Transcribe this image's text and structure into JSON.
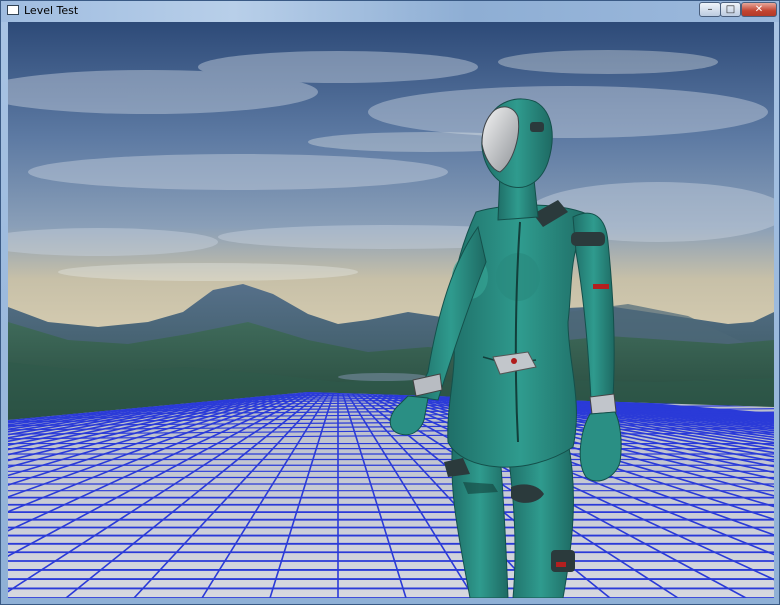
{
  "window": {
    "title": "Level Test",
    "controls": {
      "minimize": "–",
      "maximize": "□",
      "close": "✕"
    }
  },
  "scene": {
    "sky": "cloudy-sky",
    "terrain": "forested-mountains",
    "floor": "blue-grid-floor",
    "character": "teal-android-woman"
  },
  "colors": {
    "grid_line": "#2a3ad8",
    "floor": "#c9ccd6",
    "character_body": "#2a8f84",
    "close_button": "#c24431"
  }
}
